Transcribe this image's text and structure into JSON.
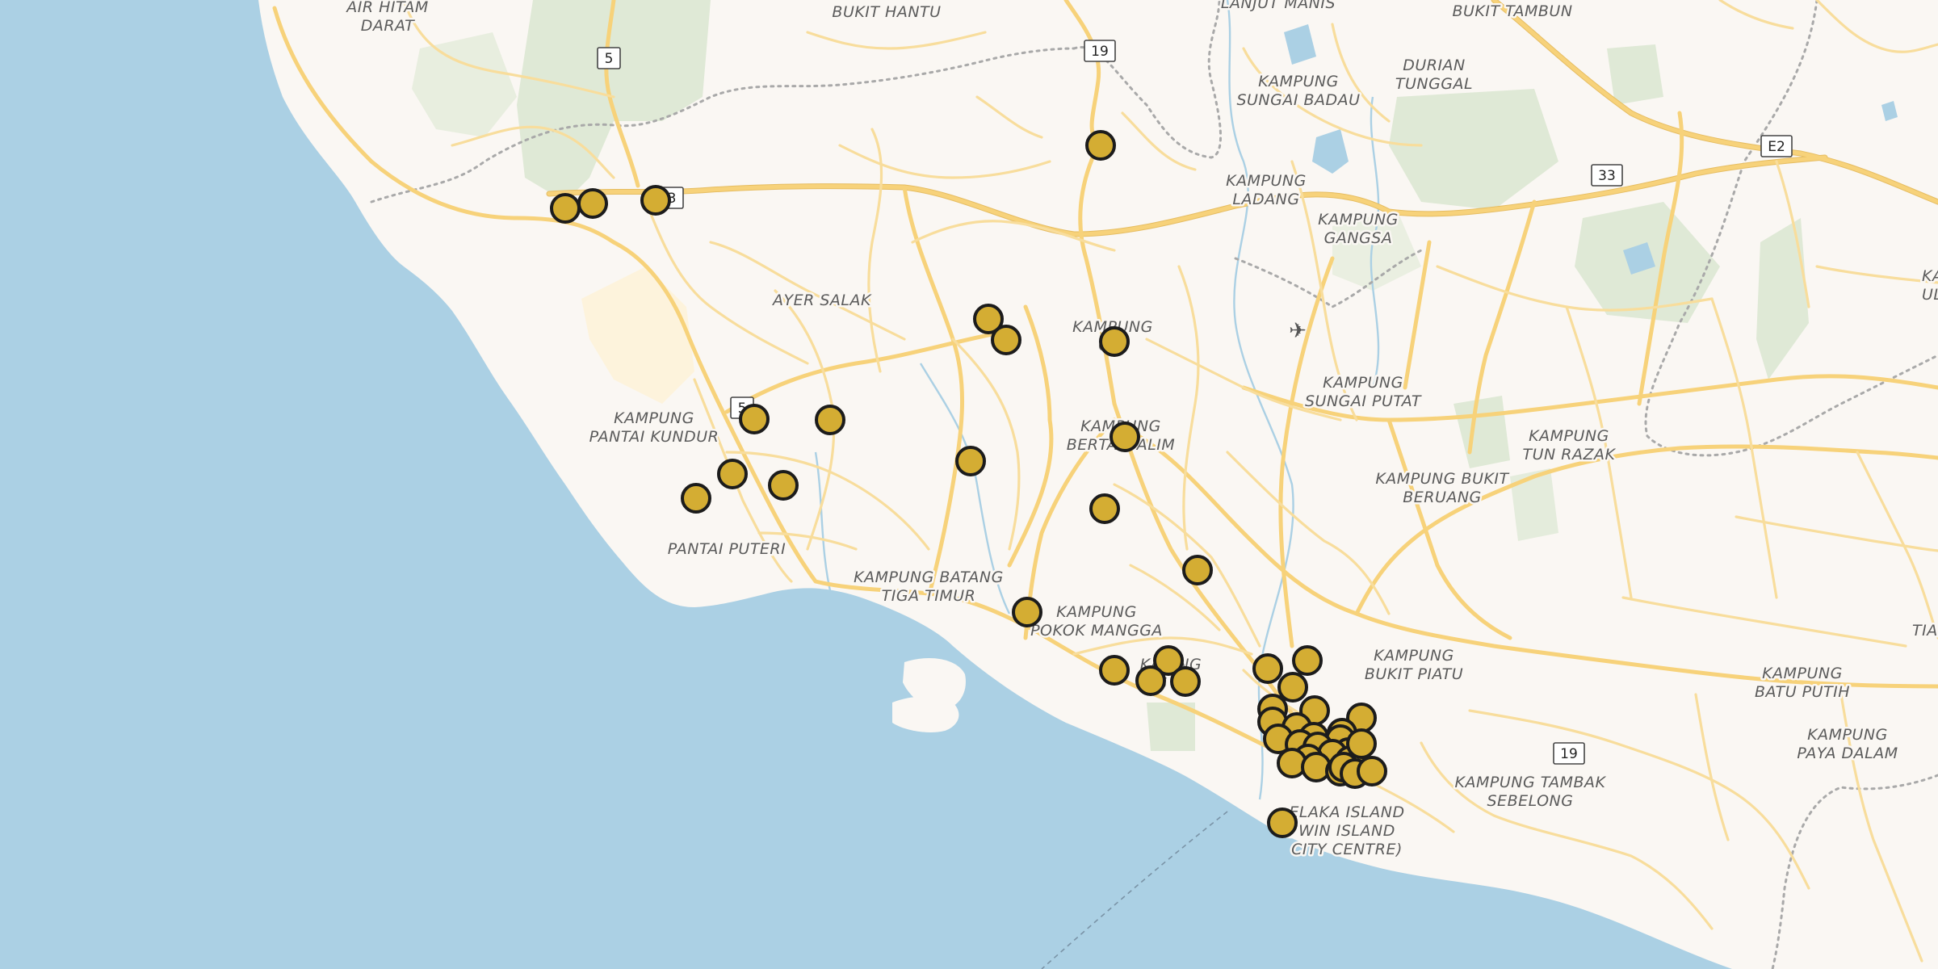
{
  "map": {
    "colors": {
      "sea": "#abd0e4",
      "land": "#faf7f3",
      "park": "#dfe9d6",
      "road": "#f7d27a",
      "marker_fill": "#d4ad33",
      "marker_stroke": "#1c1c1c"
    },
    "places": [
      {
        "id": "air-hitam-darat",
        "lines": [
          "AIR HITAM",
          "DARAT"
        ]
      },
      {
        "id": "bukit-hantu",
        "lines": [
          "BUKIT HANTU"
        ]
      },
      {
        "id": "lanjut-manis",
        "lines": [
          "LANJUT MANIS"
        ]
      },
      {
        "id": "bukit-tambun",
        "lines": [
          "BUKIT TAMBUN"
        ]
      },
      {
        "id": "durian-tunggal",
        "lines": [
          "DURIAN",
          "TUNGGAL"
        ]
      },
      {
        "id": "kampung-sungai-badau",
        "lines": [
          "KAMPUNG",
          "SUNGAI BADAU"
        ]
      },
      {
        "id": "kampung-ladang",
        "lines": [
          "KAMPUNG",
          "LADANG"
        ]
      },
      {
        "id": "kampung-gangsa",
        "lines": [
          "KAMPUNG",
          "GANGSA"
        ]
      },
      {
        "id": "ayer-salak",
        "lines": [
          "AYER SALAK"
        ]
      },
      {
        "id": "kampung-cheng",
        "lines": [
          "KAMPUNG",
          "C   G"
        ]
      },
      {
        "id": "kampung-sungai-putat",
        "lines": [
          "KAMPUNG",
          "SUNGAI PUTAT"
        ]
      },
      {
        "id": "kampung-tun-razak",
        "lines": [
          "KAMPUNG",
          "TUN RAZAK"
        ]
      },
      {
        "id": "kampung-pantai-kundur",
        "lines": [
          "KAMPUNG",
          "PANTAI KUNDUR"
        ]
      },
      {
        "id": "kampung-bertam-malim",
        "lines": [
          "KAMPUNG",
          "BERTAM   ALIM"
        ]
      },
      {
        "id": "kampung-bukit-beruang",
        "lines": [
          "KAMPUNG BUKIT",
          "BERUANG"
        ]
      },
      {
        "id": "pantai-puteri",
        "lines": [
          "PANTAI PUTERI"
        ]
      },
      {
        "id": "kampung-batang-tiga-timur",
        "lines": [
          "KAMPUNG BATANG",
          "TIGA TIMUR"
        ]
      },
      {
        "id": "kampung-pokok-mangga",
        "lines": [
          "KAMPUNG",
          "POKOK MANGGA"
        ]
      },
      {
        "id": "kampung-bukit-piatu",
        "lines": [
          "KAMPUNG",
          "BUKIT PIATU"
        ]
      },
      {
        "id": "kampung-semabok",
        "lines": [
          "KA   ANG",
          "S        N"
        ]
      },
      {
        "id": "kampung-tambak-sebelong",
        "lines": [
          "KAMPUNG TAMBAK",
          "SEBELONG"
        ]
      },
      {
        "id": "melaka-island",
        "lines": [
          "  ELAKA ISLAND",
          "  WIN ISLAND",
          "CITY CENTRE)"
        ]
      },
      {
        "id": "kampung-batu-putih",
        "lines": [
          "KAMPUNG",
          "BATU PUTIH"
        ]
      },
      {
        "id": "kampung-paya-dalam",
        "lines": [
          "KAMPUNG",
          "PAYA DALAM"
        ]
      },
      {
        "id": "tiang-dua",
        "lines": [
          "TIANG D"
        ]
      },
      {
        "id": "kampung-ulu",
        "lines": [
          "KA",
          "ULU"
        ]
      }
    ],
    "shields": [
      {
        "id": "route-5-north",
        "label": "5"
      },
      {
        "id": "route-19-north",
        "label": "19"
      },
      {
        "id": "route-e2",
        "label": "E2"
      },
      {
        "id": "route-33-east",
        "label": "33"
      },
      {
        "id": "route-33-west",
        "label": "3"
      },
      {
        "id": "route-5-south",
        "label": "5"
      },
      {
        "id": "route-19-south",
        "label": "19"
      }
    ],
    "icons": [
      {
        "id": "airport",
        "icon": "airplane-icon",
        "glyph": "✈"
      }
    ],
    "marker_count": 47
  }
}
